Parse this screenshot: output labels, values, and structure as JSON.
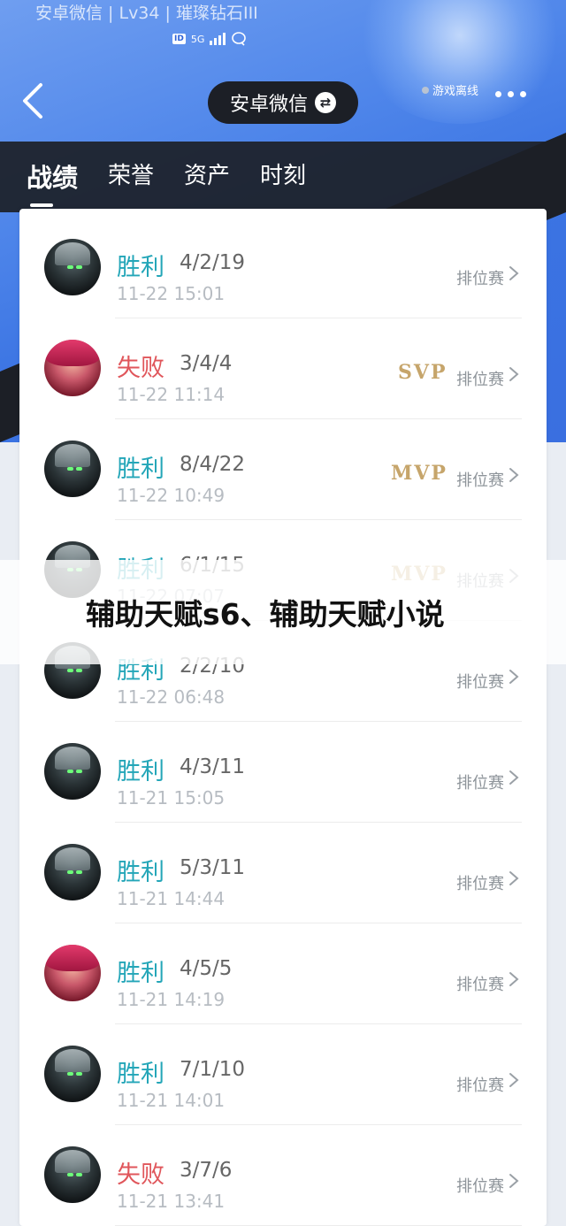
{
  "header": {
    "account_info": "安卓微信 | Lv34 | 璀璨钻石III",
    "status_5g": "5G",
    "account_switch_label": "安卓微信",
    "offline_label": "游戏离线"
  },
  "tabs": [
    {
      "label": "战绩",
      "active": true
    },
    {
      "label": "荣誉",
      "active": false
    },
    {
      "label": "资产",
      "active": false
    },
    {
      "label": "时刻",
      "active": false
    }
  ],
  "matches": [
    {
      "result": "胜利",
      "outcome": "win",
      "kda": "4/2/19",
      "time": "11-22 15:01",
      "medal": "",
      "mode": "排位赛",
      "avatar": "dark-hero"
    },
    {
      "result": "失败",
      "outcome": "lose",
      "kda": "3/4/4",
      "time": "11-22 11:14",
      "medal": "SVP",
      "mode": "排位赛",
      "avatar": "red-hero"
    },
    {
      "result": "胜利",
      "outcome": "win",
      "kda": "8/4/22",
      "time": "11-22 10:49",
      "medal": "MVP",
      "mode": "排位赛",
      "avatar": "dark-hero"
    },
    {
      "result": "胜利",
      "outcome": "win",
      "kda": "6/1/15",
      "time": "11-22 07:07",
      "medal": "MVP",
      "mode": "排位赛",
      "avatar": "dark-hero"
    },
    {
      "result": "胜利",
      "outcome": "win",
      "kda": "2/2/10",
      "time": "11-22 06:48",
      "medal": "",
      "mode": "排位赛",
      "avatar": "dark-hero"
    },
    {
      "result": "胜利",
      "outcome": "win",
      "kda": "4/3/11",
      "time": "11-21 15:05",
      "medal": "",
      "mode": "排位赛",
      "avatar": "dark-hero"
    },
    {
      "result": "胜利",
      "outcome": "win",
      "kda": "5/3/11",
      "time": "11-21 14:44",
      "medal": "",
      "mode": "排位赛",
      "avatar": "dark-hero"
    },
    {
      "result": "胜利",
      "outcome": "win",
      "kda": "4/5/5",
      "time": "11-21 14:19",
      "medal": "",
      "mode": "排位赛",
      "avatar": "red-hero"
    },
    {
      "result": "胜利",
      "outcome": "win",
      "kda": "7/1/10",
      "time": "11-21 14:01",
      "medal": "",
      "mode": "排位赛",
      "avatar": "dark-hero"
    },
    {
      "result": "失败",
      "outcome": "lose",
      "kda": "3/7/6",
      "time": "11-21 13:41",
      "medal": "",
      "mode": "排位赛",
      "avatar": "dark-hero"
    }
  ],
  "overlay": {
    "title": "辅助天赋s6、辅助天赋小说"
  },
  "colors": {
    "win": "#24a6b8",
    "lose": "#e0565b",
    "medal": "#c6a56b",
    "header_blue": "#3b74e3",
    "header_dark": "#1c1f26"
  }
}
